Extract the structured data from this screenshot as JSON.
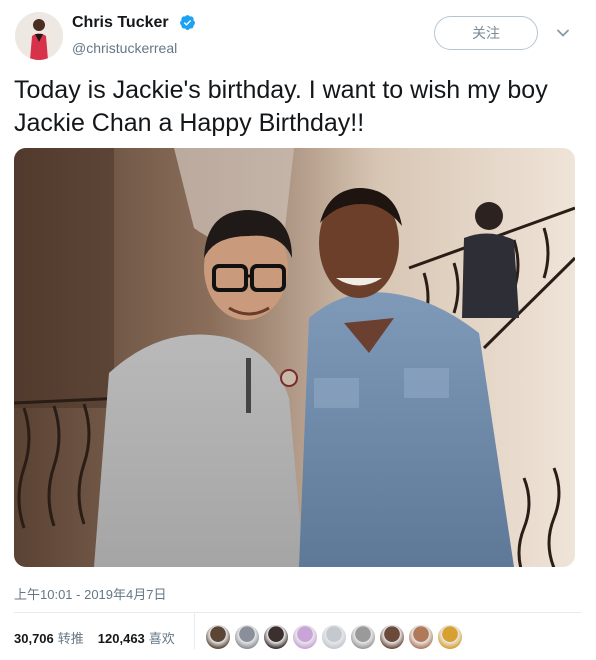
{
  "author": {
    "name": "Chris Tucker",
    "handle": "@christuckerreal",
    "verified_icon": "verified-badge-icon"
  },
  "follow_button": {
    "label": "关注"
  },
  "tweet": {
    "text": "Today is Jackie's birthday. I want to wish my boy Jackie Chan a Happy Birthday!!",
    "timestamp": "上午10:01 - 2019年4月7日"
  },
  "stats": {
    "retweets_count": "30,706",
    "retweets_label": "转推",
    "likes_count": "120,463",
    "likes_label": "喜欢"
  },
  "likers": [
    {
      "color": "#5b4636"
    },
    {
      "color": "#8a8f99"
    },
    {
      "color": "#3b2f2f"
    },
    {
      "color": "#c9a4d9"
    },
    {
      "color": "#c3c9cf"
    },
    {
      "color": "#9a9a9a"
    },
    {
      "color": "#6b4a3a"
    },
    {
      "color": "#b07a5a"
    },
    {
      "color": "#d8a030"
    }
  ],
  "colors": {
    "verified": "#1da1f2",
    "text_secondary": "#657786",
    "border": "#e6ecf0"
  }
}
